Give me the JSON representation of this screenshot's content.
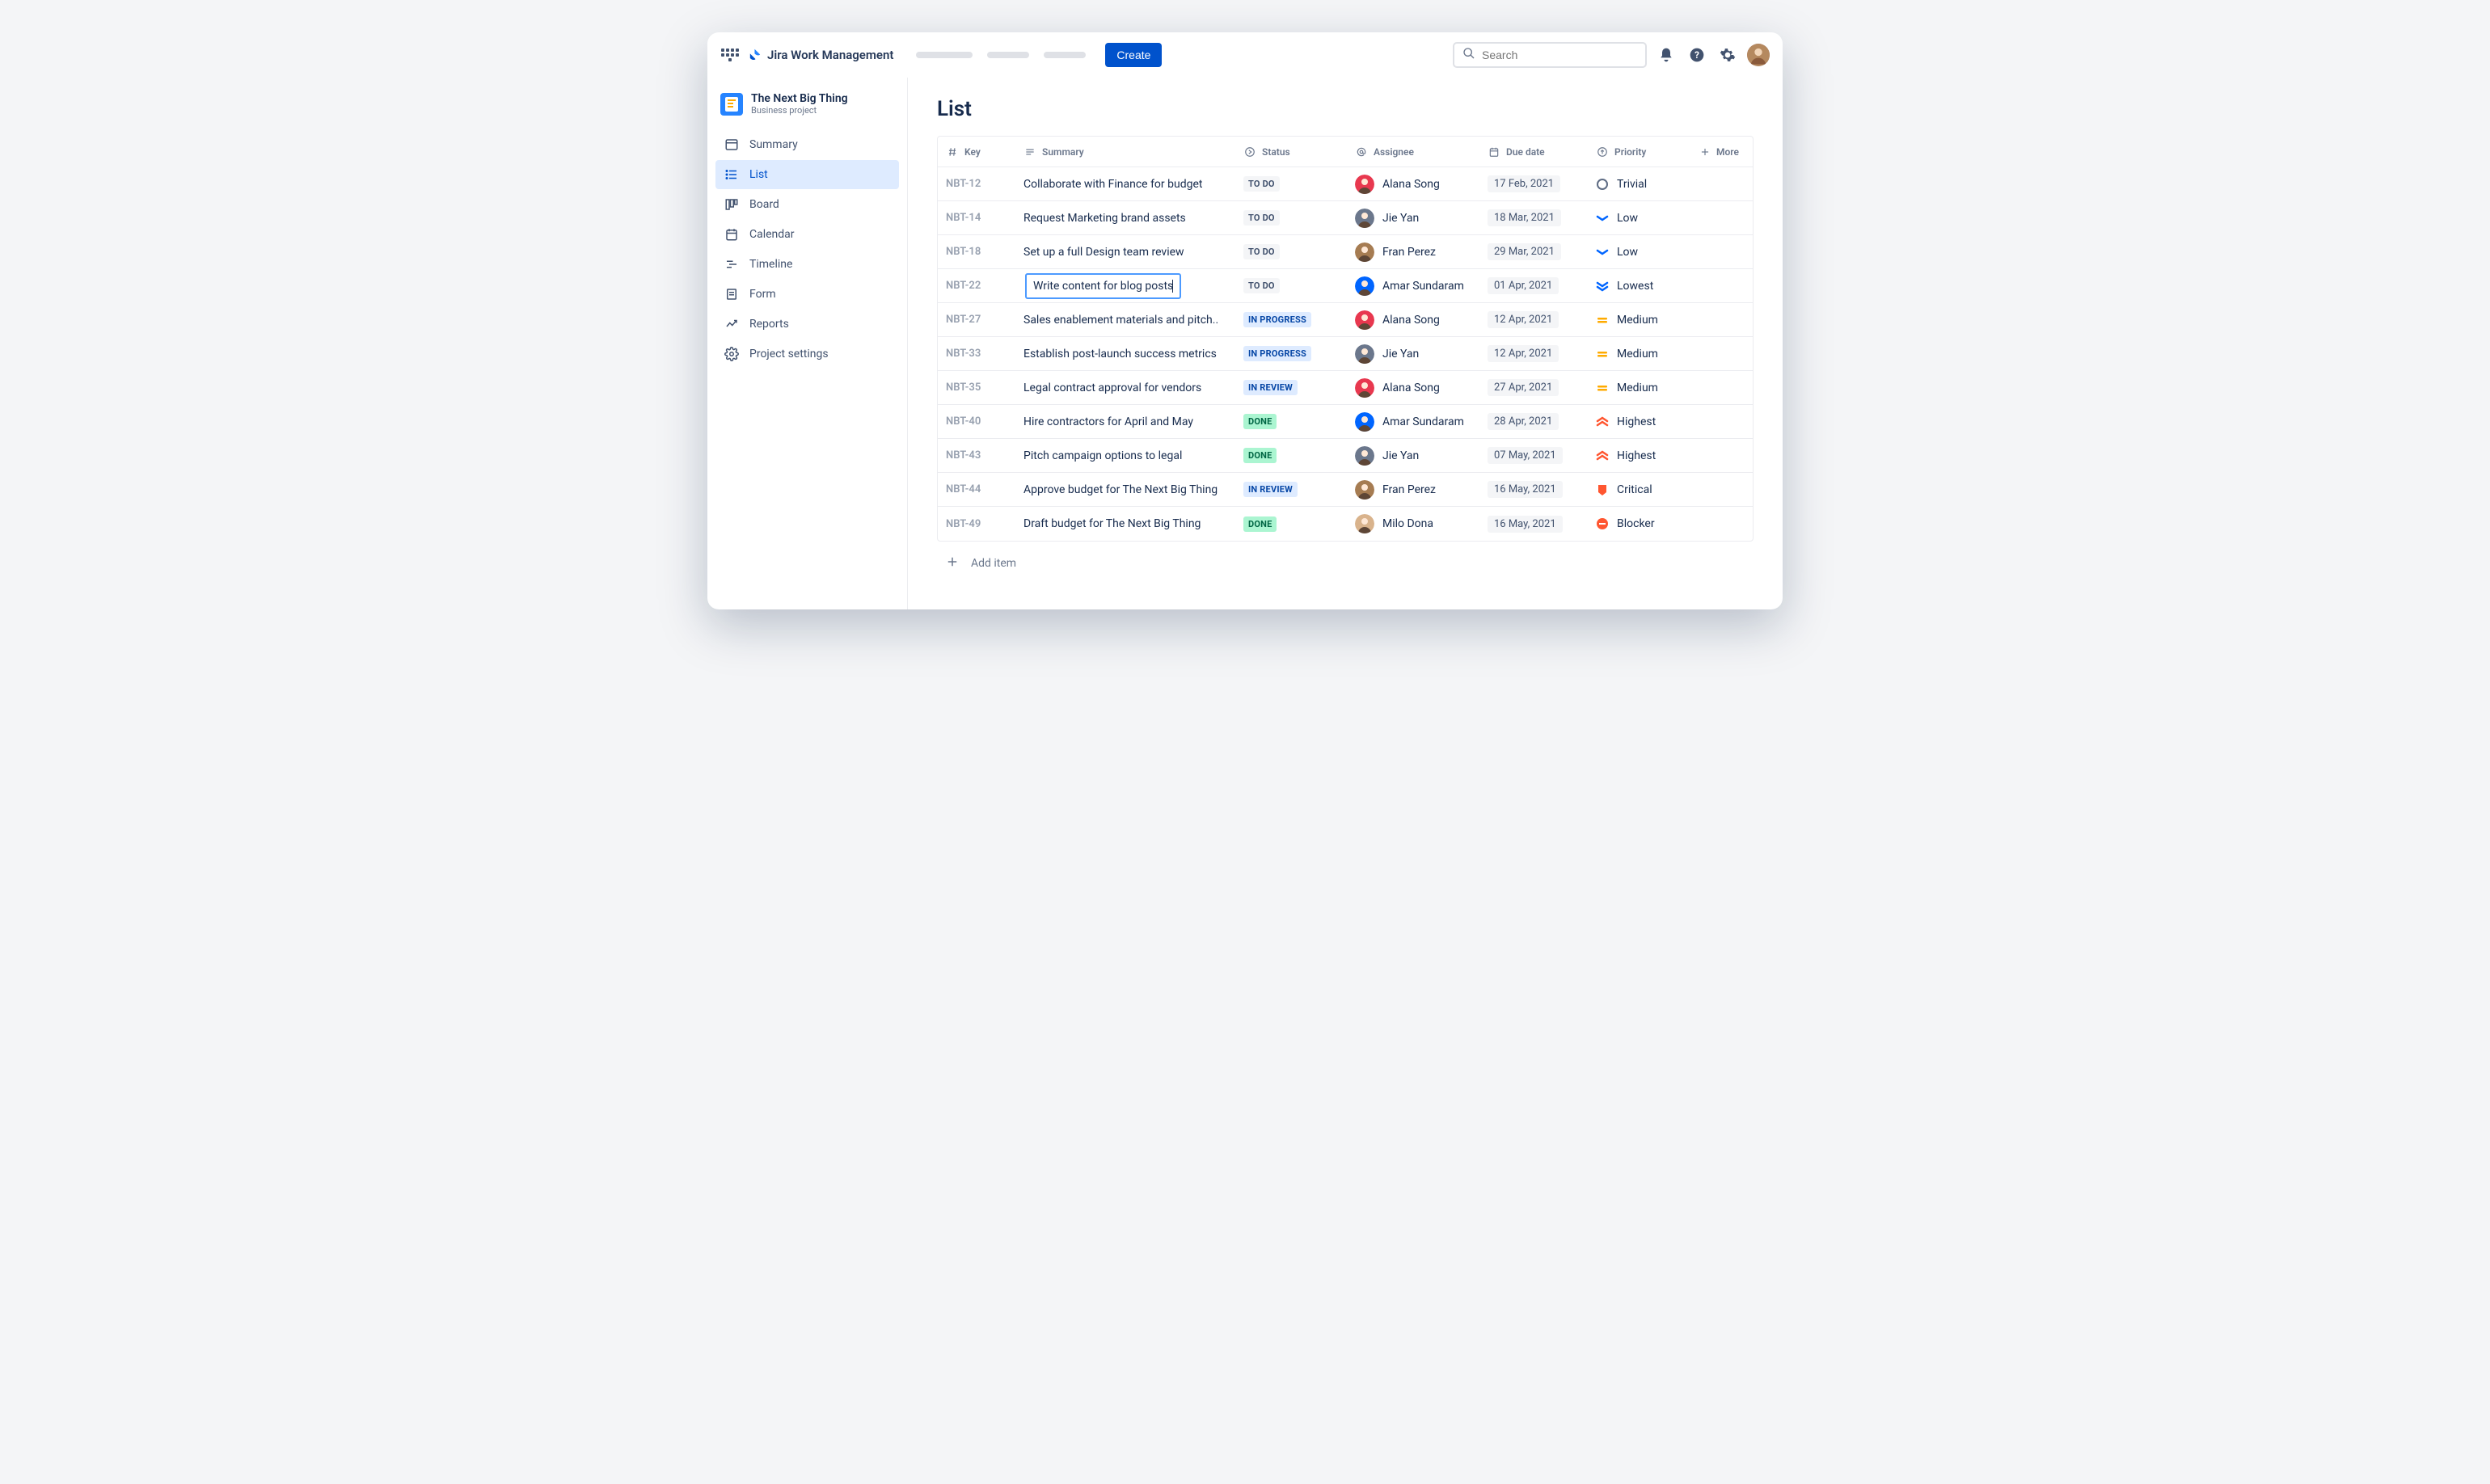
{
  "header": {
    "product": "Jira Work Management",
    "create_label": "Create",
    "search_placeholder": "Search"
  },
  "project": {
    "name": "The Next Big Thing",
    "type": "Business project"
  },
  "sidebar": {
    "items": [
      {
        "key": "summary",
        "label": "Summary"
      },
      {
        "key": "list",
        "label": "List"
      },
      {
        "key": "board",
        "label": "Board"
      },
      {
        "key": "calendar",
        "label": "Calendar"
      },
      {
        "key": "timeline",
        "label": "Timeline"
      },
      {
        "key": "form",
        "label": "Form"
      },
      {
        "key": "reports",
        "label": "Reports"
      },
      {
        "key": "settings",
        "label": "Project settings"
      }
    ],
    "active": "list"
  },
  "page": {
    "title": "List"
  },
  "columns": {
    "key": "Key",
    "summary": "Summary",
    "status": "Status",
    "assignee": "Assignee",
    "due": "Due date",
    "priority": "Priority",
    "more": "More"
  },
  "priorities": {
    "trivial": {
      "label": "Trivial",
      "color": "#5e6c84"
    },
    "low": {
      "label": "Low",
      "color": "#0065ff"
    },
    "lowest": {
      "label": "Lowest",
      "color": "#0065ff"
    },
    "medium": {
      "label": "Medium",
      "color": "#ffab00"
    },
    "highest": {
      "label": "Highest",
      "color": "#ff5630"
    },
    "critical": {
      "label": "Critical",
      "color": "#ff5630"
    },
    "blocker": {
      "label": "Blocker",
      "color": "#ff5630"
    }
  },
  "statuses": {
    "todo": {
      "label": "TO DO",
      "class": "status-todo"
    },
    "inprogress": {
      "label": "IN PROGRESS",
      "class": "status-inprogress"
    },
    "inreview": {
      "label": "IN REVIEW",
      "class": "status-inreview"
    },
    "done": {
      "label": "DONE",
      "class": "status-done"
    }
  },
  "assignees": {
    "alana": {
      "name": "Alana Song",
      "bg": "#e8384f"
    },
    "jie": {
      "name": "Jie Yan",
      "bg": "#6b778c"
    },
    "fran": {
      "name": "Fran Perez",
      "bg": "#a67c52"
    },
    "amar": {
      "name": "Amar Sundaram",
      "bg": "#0065ff"
    },
    "milo": {
      "name": "Milo Dona",
      "bg": "#d9b38c"
    }
  },
  "rows": [
    {
      "key": "NBT-12",
      "summary": "Collaborate with Finance for budget",
      "status": "todo",
      "assignee": "alana",
      "due": "17 Feb, 2021",
      "priority": "trivial",
      "editing": false
    },
    {
      "key": "NBT-14",
      "summary": "Request Marketing brand assets",
      "status": "todo",
      "assignee": "jie",
      "due": "18 Mar, 2021",
      "priority": "low",
      "editing": false
    },
    {
      "key": "NBT-18",
      "summary": "Set up a full Design team review",
      "status": "todo",
      "assignee": "fran",
      "due": "29 Mar, 2021",
      "priority": "low",
      "editing": false
    },
    {
      "key": "NBT-22",
      "summary": "Write content for blog posts",
      "status": "todo",
      "assignee": "amar",
      "due": "01 Apr, 2021",
      "priority": "lowest",
      "editing": true
    },
    {
      "key": "NBT-27",
      "summary": "Sales enablement materials and pitch..",
      "status": "inprogress",
      "assignee": "alana",
      "due": "12 Apr, 2021",
      "priority": "medium",
      "editing": false
    },
    {
      "key": "NBT-33",
      "summary": "Establish post-launch success metrics",
      "status": "inprogress",
      "assignee": "jie",
      "due": "12 Apr, 2021",
      "priority": "medium",
      "editing": false
    },
    {
      "key": "NBT-35",
      "summary": "Legal contract approval for vendors",
      "status": "inreview",
      "assignee": "alana",
      "due": "27 Apr, 2021",
      "priority": "medium",
      "editing": false
    },
    {
      "key": "NBT-40",
      "summary": "Hire contractors for April and May",
      "status": "done",
      "assignee": "amar",
      "due": "28 Apr, 2021",
      "priority": "highest",
      "editing": false
    },
    {
      "key": "NBT-43",
      "summary": "Pitch campaign options to legal",
      "status": "done",
      "assignee": "jie",
      "due": "07 May, 2021",
      "priority": "highest",
      "editing": false
    },
    {
      "key": "NBT-44",
      "summary": "Approve budget for The Next Big Thing",
      "status": "inreview",
      "assignee": "fran",
      "due": "16 May, 2021",
      "priority": "critical",
      "editing": false
    },
    {
      "key": "NBT-49",
      "summary": "Draft budget for The Next Big Thing",
      "status": "done",
      "assignee": "milo",
      "due": "16 May, 2021",
      "priority": "blocker",
      "editing": false
    }
  ],
  "add_item_label": "Add item"
}
